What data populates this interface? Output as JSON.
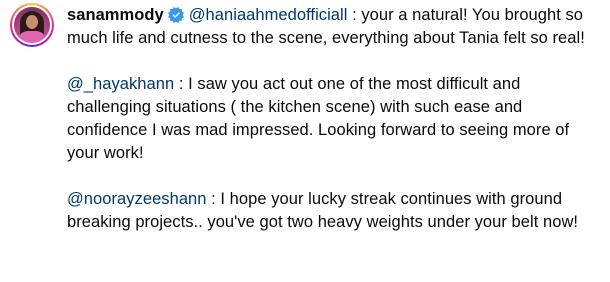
{
  "comment": {
    "username": "sanammody",
    "verified_icon": "verified-badge-icon",
    "avatar_icon": "profile-avatar",
    "accent_color": "#3897f0",
    "mention_color": "#00376b",
    "paragraphs": [
      {
        "mention": "@haniaahmedofficiall",
        "text": " : your a natural! You brought so much life and cutness to the scene, everything about Tania felt so real!"
      },
      {
        "mention": "@_hayakhann",
        "text": " : I saw you act out one of the most difficult and challenging situations ( the kitchen scene) with such ease and confidence I was mad impressed. Looking forward to seeing more of your work!"
      },
      {
        "mention": "@noorayzeeshann",
        "text": " : I hope your lucky streak continues with ground breaking projects.. you've got two heavy weights under your belt now!"
      }
    ]
  }
}
